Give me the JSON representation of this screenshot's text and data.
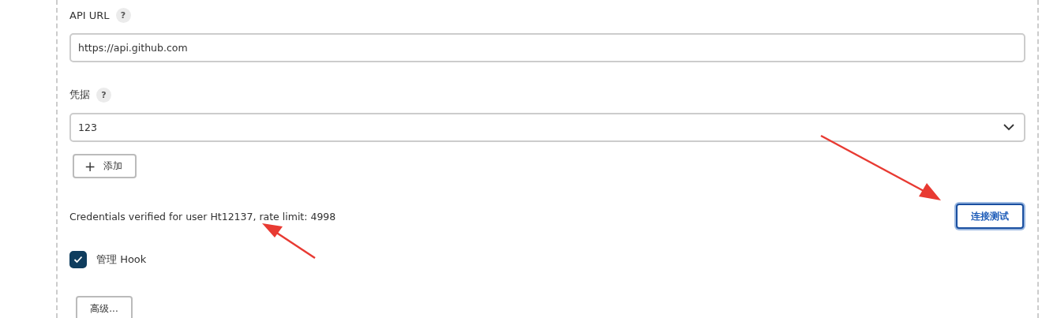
{
  "api_url": {
    "label": "API URL",
    "help": "?",
    "value": "https://api.github.com"
  },
  "credentials": {
    "label": "凭据",
    "help": "?",
    "value": "123",
    "add_button": {
      "icon": "+",
      "label": "添加"
    }
  },
  "verification_message": "Credentials verified for user Ht12137, rate limit: 4998",
  "test_button": {
    "label": "连接测试",
    "focused": true
  },
  "manage_hook": {
    "label": "管理 Hook",
    "checked": true
  },
  "advanced_button": "高级..."
}
